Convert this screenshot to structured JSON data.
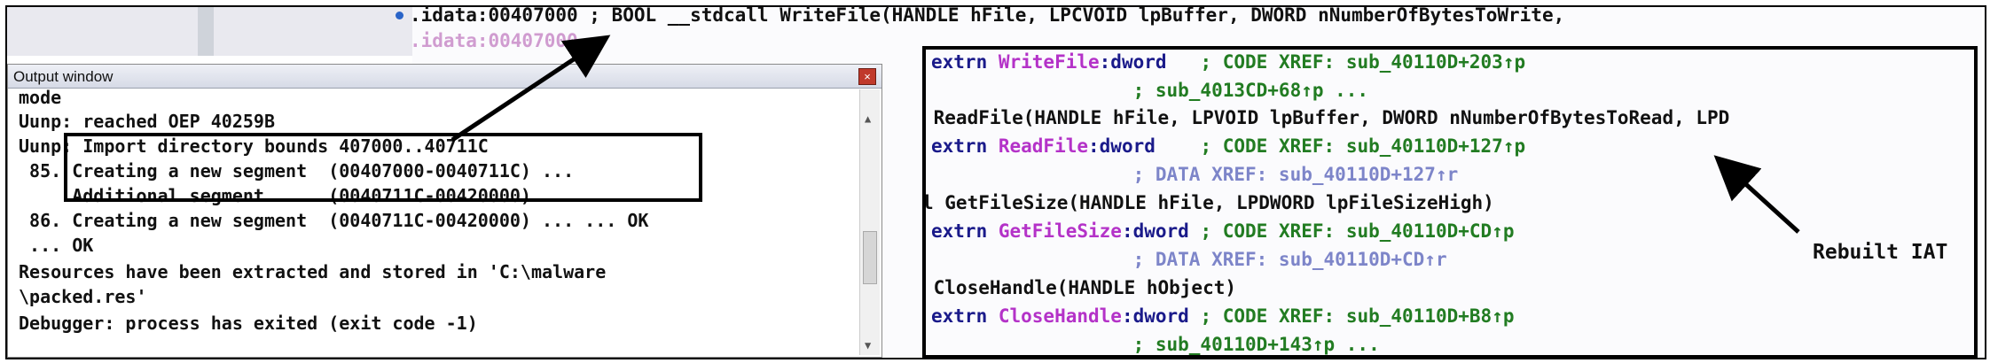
{
  "ida_top": {
    "line1": ".idata:00407000 ; BOOL __stdcall WriteFile(HANDLE hFile, LPCVOID lpBuffer, DWORD nNumberOfBytesToWrite,",
    "line2": ".idata:00407000"
  },
  "output_window": {
    "title": "Output window",
    "close_glyph": "×",
    "lines": [
      "mode",
      "Uunp: reached OEP 40259B",
      "Uunp: Import directory bounds 407000..40711C",
      " 85. Creating a new segment  (00407000-0040711C) ...",
      "     Additional segment      (0040711C-00420000) ...",
      " 86. Creating a new segment  (0040711C-00420000) ... ... OK",
      " ... OK",
      "Resources have been extracted and stored in 'C:\\malware",
      "\\packed.res'",
      "Debugger: process has exited (exit code -1)"
    ]
  },
  "iat": {
    "row1_kw": "extrn ",
    "row1_fn": "WriteFile",
    "row1_type": ":dword   ",
    "row1_xref": "; CODE XREF: sub_40110D+203↑p",
    "row2": "                  ; sub_4013CD+68↑p ...",
    "row3": " ReadFile(HANDLE hFile, LPVOID lpBuffer, DWORD nNumberOfBytesToRead, LPD",
    "row4_kw": "extrn ",
    "row4_fn": "ReadFile",
    "row4_type": ":dword    ",
    "row4_xref": "; CODE XREF: sub_40110D+127↑p",
    "row5": "                  ; DATA XREF: sub_40110D+127↑r",
    "row6": "l GetFileSize(HANDLE hFile, LPDWORD lpFileSizeHigh)",
    "row7_kw": "extrn ",
    "row7_fn": "GetFileSize",
    "row7_type": ":dword ",
    "row7_xref": "; CODE XREF: sub_40110D+CD↑p",
    "row8": "                  ; DATA XREF: sub_40110D+CD↑r",
    "row9": " CloseHandle(HANDLE hObject)",
    "row10_kw": "extrn ",
    "row10_fn": "CloseHandle",
    "row10_type": ":dword ",
    "row10_xref": "; CODE XREF: sub_40110D+B8↑p",
    "row11": "                  ; sub_40110D+143↑p ..."
  },
  "annotation": {
    "label": "Rebuilt IAT"
  },
  "colors": {
    "keyword": "#1a1a8a",
    "function_name": "#b432c8",
    "code_xref": "#227c22",
    "data_xref": "#7d85c9"
  }
}
